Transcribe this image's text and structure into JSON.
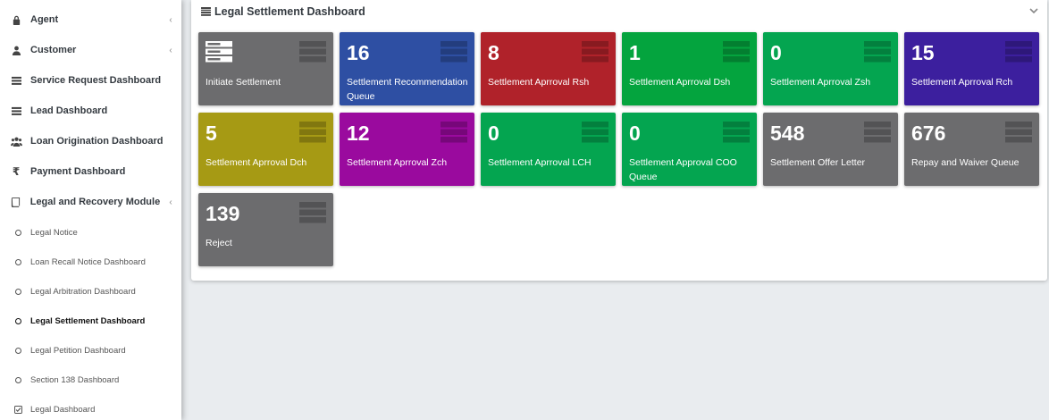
{
  "sidebar": {
    "items": [
      {
        "label": "Agent",
        "icon": "lock-icon",
        "chevron": "‹"
      },
      {
        "label": "Customer",
        "icon": "user-icon",
        "chevron": "‹"
      },
      {
        "label": "Service Request Dashboard",
        "icon": "list-icon"
      },
      {
        "label": "Lead Dashboard",
        "icon": "list-icon"
      },
      {
        "label": "Loan Origination Dashboard",
        "icon": "users-icon"
      },
      {
        "label": "Payment Dashboard",
        "icon": "rupee-icon",
        "symbol": "₹"
      },
      {
        "label": "Legal and Recovery Module",
        "icon": "book-icon",
        "chevron": "‹"
      }
    ],
    "subitems": [
      {
        "label": "Legal Notice"
      },
      {
        "label": "Loan Recall Notice Dashboard"
      },
      {
        "label": "Legal Arbitration Dashboard"
      },
      {
        "label": "Legal Settlement Dashboard",
        "active": true
      },
      {
        "label": "Legal Petition Dashboard"
      },
      {
        "label": "Section 138 Dashboard"
      },
      {
        "label": "Legal Dashboard",
        "icon": "checkbox-icon"
      }
    ]
  },
  "card": {
    "title": "Legal Settlement Dashboard",
    "collapse_icon": "chevron-down-icon"
  },
  "tiles": [
    {
      "number": "",
      "label": "Initiate Settlement",
      "color": "#6c6c6e"
    },
    {
      "number": "16",
      "label": "Settlement Recommendation Queue",
      "color": "#2e4fa3"
    },
    {
      "number": "8",
      "label": "Settlement Aprroval Rsh",
      "color": "#b0222a"
    },
    {
      "number": "1",
      "label": "Settlement Aprroval Dsh",
      "color": "#04a43e"
    },
    {
      "number": "0",
      "label": "Settlement Aprroval Zsh",
      "color": "#04a550"
    },
    {
      "number": "15",
      "label": "Settlement Aprroval Rch",
      "color": "#3c1f9e"
    },
    {
      "number": "5",
      "label": "Settlement Aprroval Dch",
      "color": "#a69a14"
    },
    {
      "number": "12",
      "label": "Settlement Aprroval Zch",
      "color": "#9a0a9e"
    },
    {
      "number": "0",
      "label": "Settlement Aprroval LCH",
      "color": "#04a550"
    },
    {
      "number": "0",
      "label": "Settlement Approval COO Queue",
      "color": "#04a550"
    },
    {
      "number": "548",
      "label": "Settlement Offer Letter",
      "color": "#6c6c6e"
    },
    {
      "number": "676",
      "label": "Repay and Waiver Queue",
      "color": "#6c6c6e"
    },
    {
      "number": "139",
      "label": "Reject",
      "color": "#6c6c6e"
    }
  ]
}
